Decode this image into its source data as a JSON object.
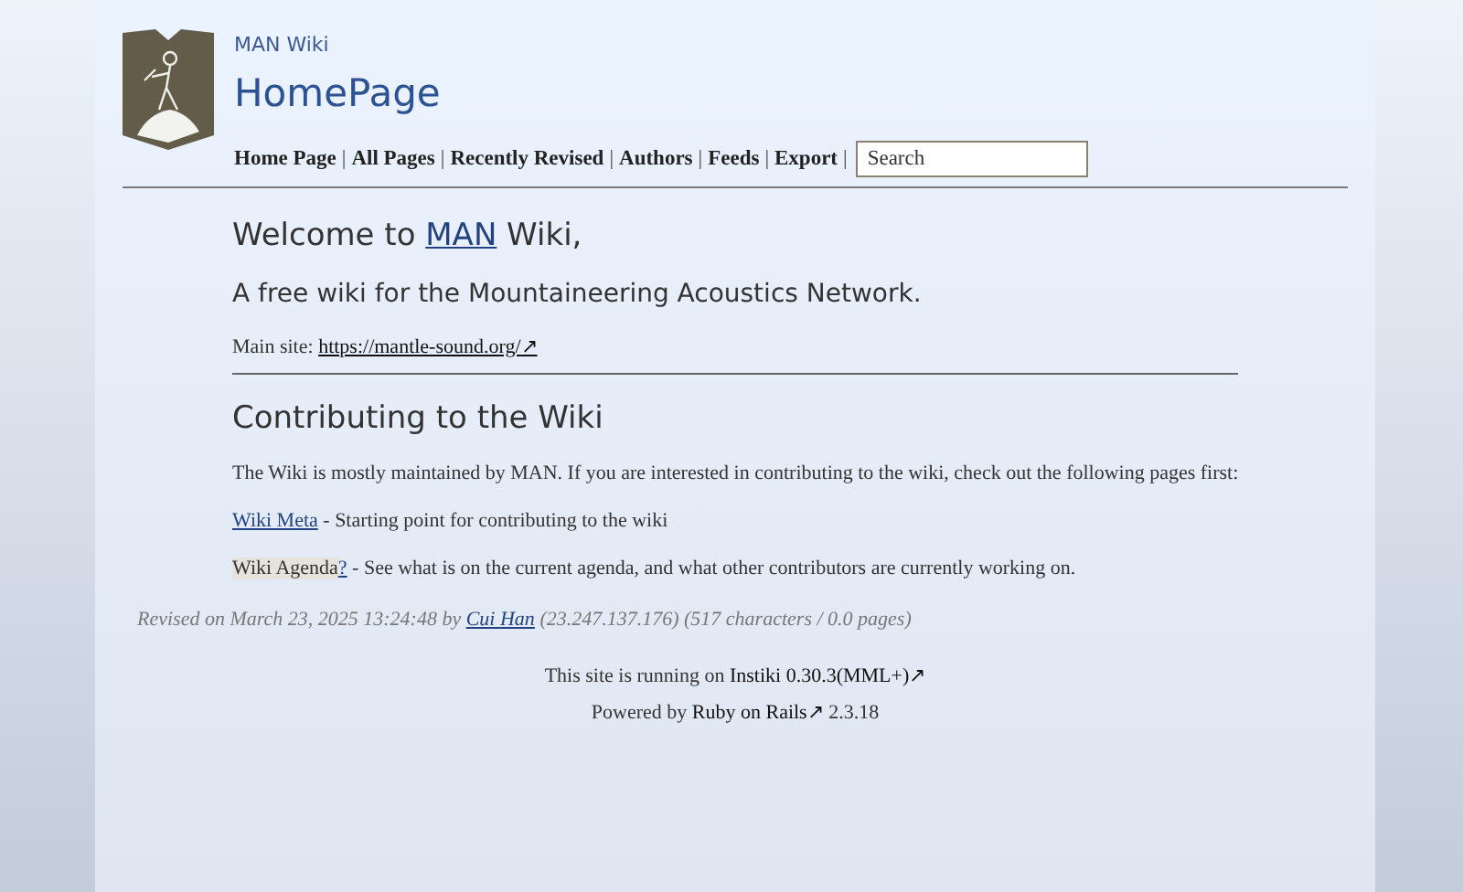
{
  "header": {
    "site_name": "MAN Wiki",
    "page_title": "HomePage"
  },
  "nav": {
    "separator": "|",
    "items": [
      "Home Page",
      "All Pages",
      "Recently Revised",
      "Authors",
      "Feeds",
      "Export"
    ]
  },
  "search": {
    "placeholder": "Search"
  },
  "content": {
    "welcome": {
      "before": "Welcome to ",
      "link": "MAN",
      "after": " Wiki,"
    },
    "tagline": "A free wiki for the Mountaineering Acoustics Network.",
    "main_site": {
      "label": "Main site: ",
      "link": "https://mantle-sound.org/↗"
    },
    "section_heading": "Contributing to the Wiki",
    "intro": "The Wiki is mostly maintained by MAN. If you are interested in contributing to the wiki, check out the following pages first:",
    "pages": [
      {
        "title": "Wiki Meta",
        "exists": true,
        "description": " - Starting point for contributing to the wiki"
      },
      {
        "title": "Wiki Agenda",
        "exists": false,
        "missing_mark": "?",
        "description": " - See what is on the current agenda, and what other contributors are currently working on."
      }
    ]
  },
  "revision": {
    "before": "Revised on March 23, 2025 13:24:48 by ",
    "author": "Cui Han",
    "after": " (23.247.137.176) (517 characters / 0.0 pages)"
  },
  "footer": [
    {
      "before": "This site is running on ",
      "link": "Instiki 0.30.3(MML+)↗"
    },
    {
      "before": "Powered by ",
      "link": "Ruby on Rails↗",
      "after": " 2.3.18"
    }
  ]
}
